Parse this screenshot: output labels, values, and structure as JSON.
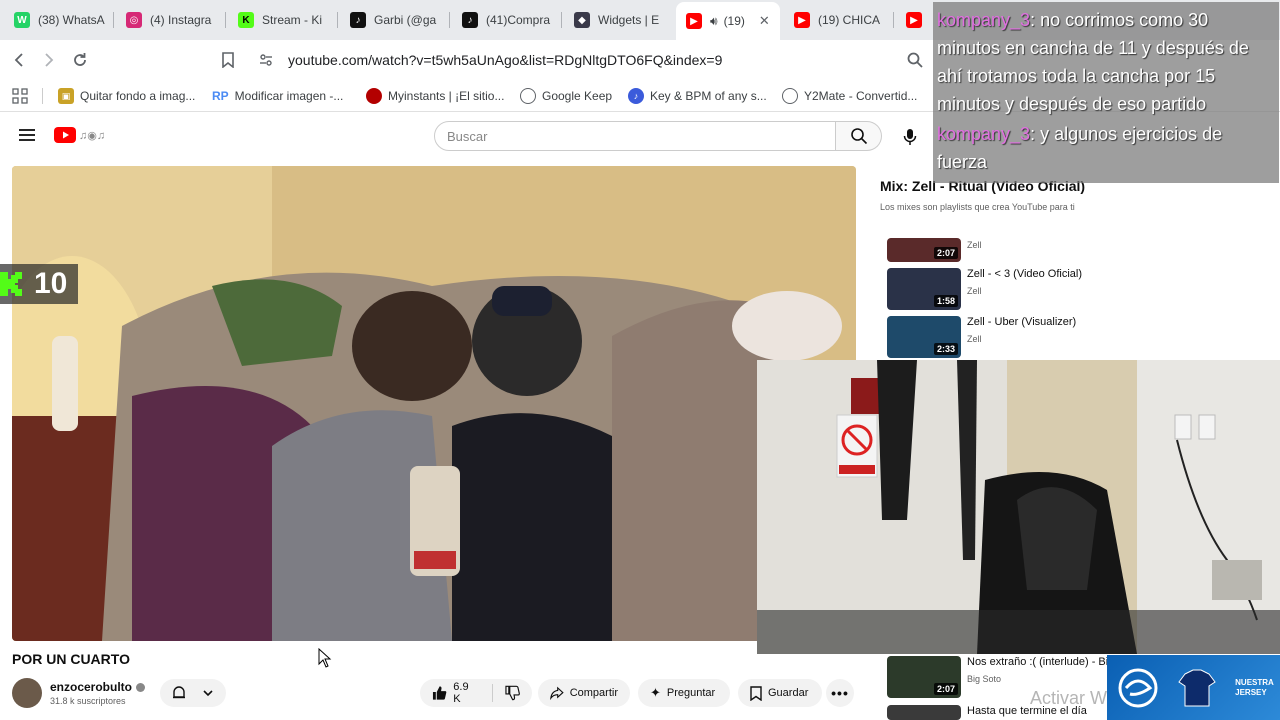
{
  "tabs": [
    {
      "label": "(38) WhatsA",
      "color": "#25d366",
      "glyph": "W"
    },
    {
      "label": "(4) Instagra",
      "color": "#d62976",
      "glyph": "I"
    },
    {
      "label": "Stream - Ki",
      "color": "#53fc18",
      "glyph": "K"
    },
    {
      "label": "Garbi (@ga",
      "color": "#111111",
      "glyph": "♪"
    },
    {
      "label": "(41)Compra",
      "color": "#111111",
      "glyph": "♪"
    },
    {
      "label": "Widgets | E",
      "color": "#3a3a4a",
      "glyph": "◆"
    },
    {
      "label": "(19)",
      "color": "#ff0000",
      "glyph": "▶",
      "active": true
    },
    {
      "label": "(19) CHICA",
      "color": "#ff0000",
      "glyph": "▶"
    },
    {
      "label": "",
      "color": "#ff0000",
      "glyph": "▶"
    }
  ],
  "address": {
    "url": "youtube.com/watch?v=t5wh5aUnAgo&list=RDgNltgDTO6FQ&index=9"
  },
  "bookmarks": [
    {
      "label": "Quitar fondo a imag...",
      "color": "#c9a227",
      "glyph": "▣"
    },
    {
      "label": "Modificar imagen -...",
      "color": "#4a8af4",
      "glyph": "RP"
    },
    {
      "label": "Myinstants | ¡El sitio...",
      "color": "#b30000",
      "glyph": "●"
    },
    {
      "label": "Google Keep",
      "color": "#5f6368",
      "glyph": "◎"
    },
    {
      "label": "Key & BPM of any s...",
      "color": "#3b5bdb",
      "glyph": "♪"
    },
    {
      "label": "Y2Mate - Convertid...",
      "color": "#5f6368",
      "glyph": "◎"
    }
  ],
  "youtube": {
    "search_placeholder": "Buscar"
  },
  "video": {
    "title": "POR UN CUARTO",
    "kick_count": "10",
    "channel_name": "enzocerobulto",
    "subscribers": "31.8 k suscriptores",
    "likes": "6.9 K",
    "share_label": "Compartir",
    "ask_label": "Preguntar",
    "save_label": "Guardar"
  },
  "playlist": {
    "title": "Mix: Zell - Ritual (Video Oficial)",
    "subtitle": "Los mixes son playlists que crea YouTube para ti",
    "items": [
      {
        "title": "",
        "channel": "Zell",
        "duration": "2:07",
        "thumb": "#5a2a2a"
      },
      {
        "title": "Zell - < 3 (Video Oficial)",
        "channel": "Zell",
        "duration": "1:58",
        "thumb": "#2a3248"
      },
      {
        "title": "Zell - Uber (Visualizer)",
        "channel": "Zell",
        "duration": "2:33",
        "thumb": "#1e4a6a"
      },
      {
        "title": "Nos extraño :( (interlude) - Big",
        "channel": "Big Soto",
        "duration": "2:07",
        "thumb": "#2c3a2a"
      },
      {
        "title": "Hasta que termine el día",
        "channel": "",
        "duration": "",
        "thumb": "#3a3a3a"
      }
    ]
  },
  "chat": [
    {
      "user": "kompany_3",
      "message": ": no corrimos como 30 minutos en cancha de 11 y después de ahí trotamos toda la cancha por 15 minutos y después de eso partido"
    },
    {
      "user": "kompany_3",
      "message": ": y algunos ejercicios de fuerza"
    }
  ],
  "overlay": {
    "activate_text": "Activar W",
    "brand_text": "NUESTRA JERSEY"
  }
}
